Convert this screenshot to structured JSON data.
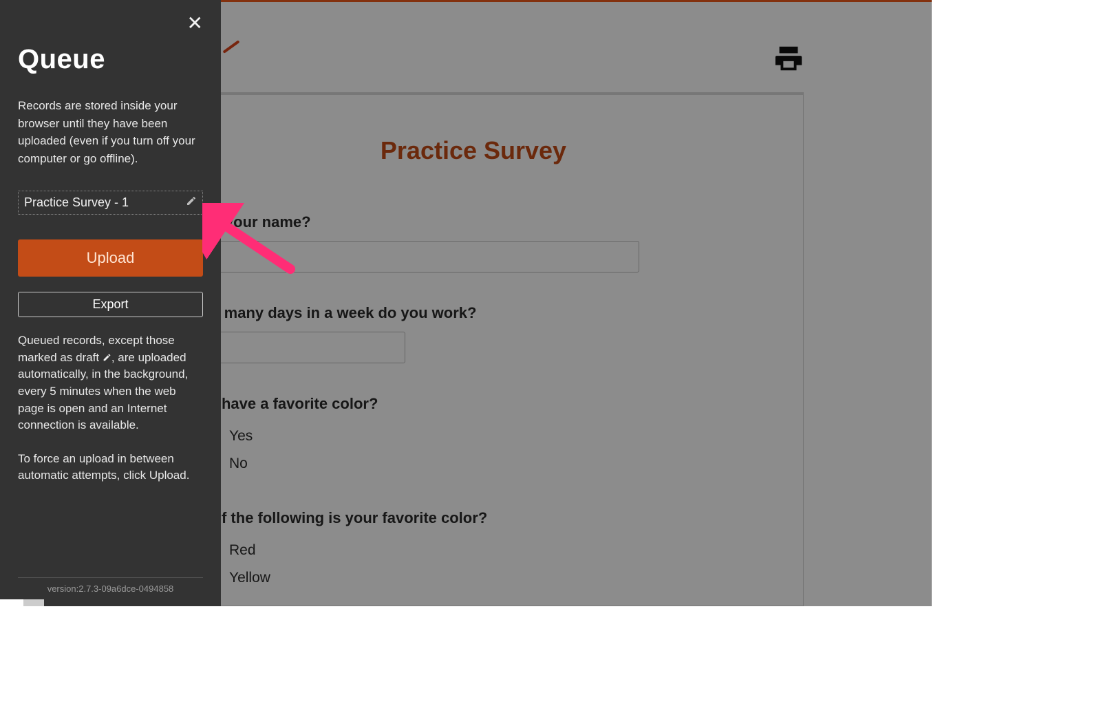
{
  "sidebar": {
    "title": "Queue",
    "intro": "Records are stored inside your browser until they have been uploaded (even if you turn off your computer or go offline).",
    "record_name": "Practice Survey - 1",
    "upload_label": "Upload",
    "export_label": "Export",
    "note1_pre": "Queued records, except those marked as draft ",
    "note1_post": ", are uploaded automatically, in the background, every 5 minutes when the web page is open and an Internet connection is available.",
    "note2": "To force an upload in between automatic attempts, click Upload.",
    "version": "version:2.7.3-09a6dce-0494858"
  },
  "survey": {
    "title": "Practice Survey",
    "q1": {
      "label": "What is your name?",
      "label_visible": "t is your name?"
    },
    "q2": {
      "label": "How many days in a week do you work?",
      "label_visible": "ow many days in a week do you work?"
    },
    "q3": {
      "label": "Do you have a favorite color?",
      "label_visible": "ou have a favorite color?",
      "opt1": "Yes",
      "opt2": "No"
    },
    "q4": {
      "label": "Which of the following is your favorite color?",
      "label_visible": "h of the following is your favorite color?",
      "opt1": "Red",
      "opt2": "Yellow"
    }
  },
  "colors": {
    "accent": "#c34c17",
    "sidebar_bg": "#333333",
    "arrow": "#ff2d76"
  }
}
